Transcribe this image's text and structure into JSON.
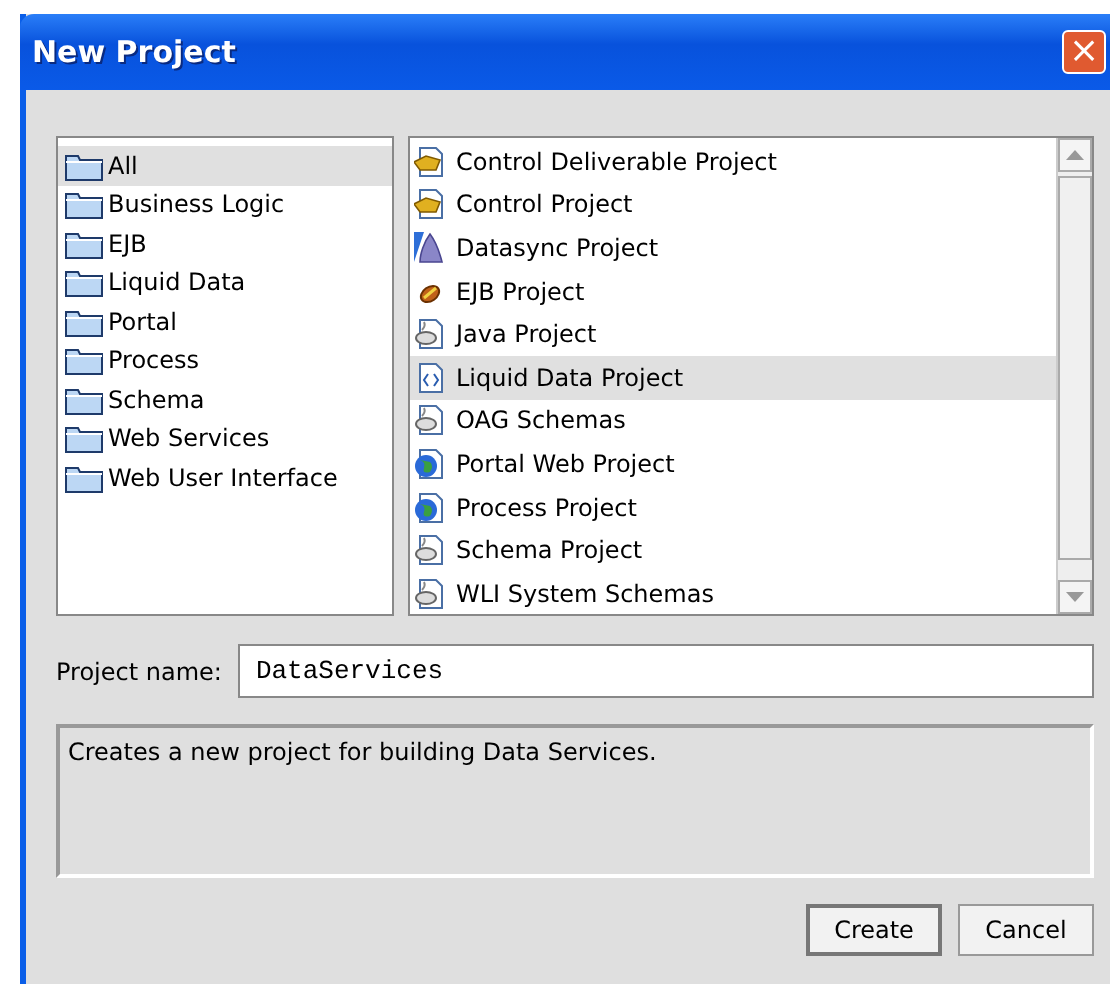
{
  "window": {
    "title": "New Project",
    "close": "×"
  },
  "categories": [
    {
      "label": "All",
      "selected": true
    },
    {
      "label": "Business Logic",
      "selected": false
    },
    {
      "label": "EJB",
      "selected": false
    },
    {
      "label": "Liquid Data",
      "selected": false
    },
    {
      "label": "Portal",
      "selected": false
    },
    {
      "label": "Process",
      "selected": false
    },
    {
      "label": "Schema",
      "selected": false
    },
    {
      "label": "Web Services",
      "selected": false
    },
    {
      "label": "Web User Interface",
      "selected": false
    }
  ],
  "templates": [
    {
      "label": "Control Deliverable Project",
      "kind": "control",
      "selected": false
    },
    {
      "label": "Control Project",
      "kind": "control",
      "selected": false
    },
    {
      "label": "Datasync Project",
      "kind": "datasync",
      "selected": false
    },
    {
      "label": "EJB Project",
      "kind": "ejb",
      "selected": false
    },
    {
      "label": "Java Project",
      "kind": "java",
      "selected": false
    },
    {
      "label": "Liquid Data Project",
      "kind": "code",
      "selected": true
    },
    {
      "label": "OAG Schemas",
      "kind": "java",
      "selected": false
    },
    {
      "label": "Portal Web Project",
      "kind": "globe",
      "selected": false
    },
    {
      "label": "Process Project",
      "kind": "globe",
      "selected": false
    },
    {
      "label": "Schema Project",
      "kind": "java",
      "selected": false
    },
    {
      "label": "WLI System Schemas",
      "kind": "java",
      "selected": false
    }
  ],
  "project_name": {
    "label": "Project name:",
    "value": "DataServices"
  },
  "description": "Creates a new project for building Data Services.",
  "buttons": [
    {
      "label": "Create",
      "default": true
    },
    {
      "label": "Cancel",
      "default": false
    }
  ]
}
